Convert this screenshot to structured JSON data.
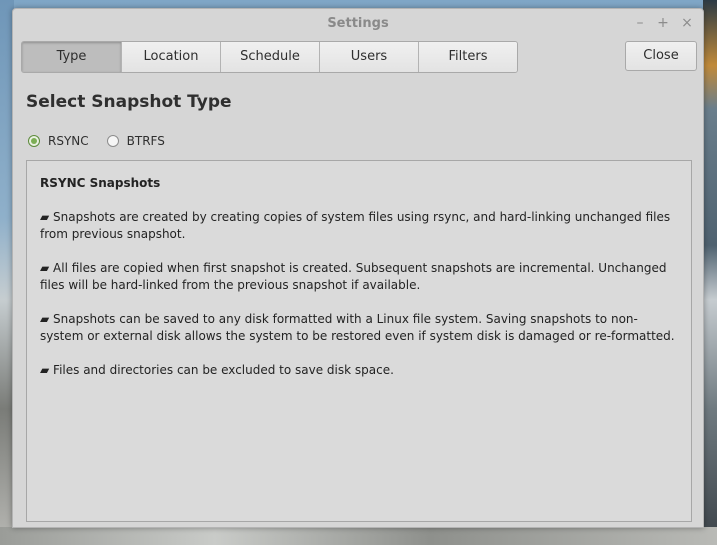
{
  "window": {
    "title": "Settings",
    "controls": {
      "minimize": "–",
      "maximize": "+",
      "close": "×"
    }
  },
  "tabs": [
    {
      "label": "Type",
      "active": true
    },
    {
      "label": "Location",
      "active": false
    },
    {
      "label": "Schedule",
      "active": false
    },
    {
      "label": "Users",
      "active": false
    },
    {
      "label": "Filters",
      "active": false
    }
  ],
  "close_button": {
    "label": "Close"
  },
  "heading": "Select Snapshot Type",
  "snapshot_type": {
    "options": [
      {
        "label": "RSYNC",
        "selected": true
      },
      {
        "label": "BTRFS",
        "selected": false
      }
    ]
  },
  "description": {
    "title": "RSYNC Snapshots",
    "paragraphs": [
      "▰ Snapshots are created by creating copies of system files using rsync, and hard-linking unchanged files from previous snapshot.",
      "▰ All files are copied when first snapshot is created. Subsequent snapshots are incremental. Unchanged files will be hard-linked from the previous snapshot if available.",
      "▰ Snapshots can be saved to any disk formatted with a Linux file system. Saving snapshots to non-system or external disk allows the system to be restored even if system disk is damaged or re-formatted.",
      "▰ Files and directories can be excluded to save disk space."
    ]
  },
  "colors": {
    "window_bg": "#d6d6d6",
    "radio_accent": "#7cae55"
  }
}
